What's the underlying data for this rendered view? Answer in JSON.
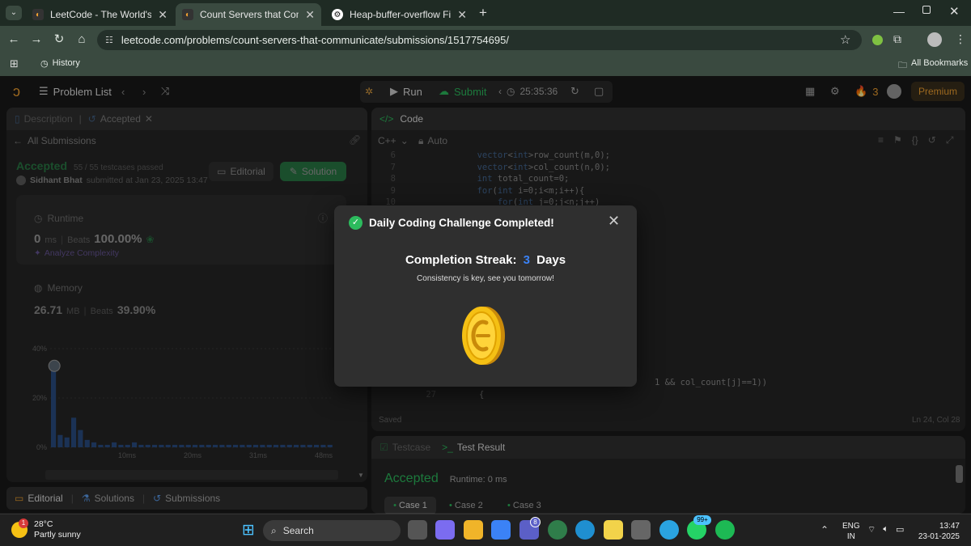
{
  "browser": {
    "tabs": [
      {
        "title": "LeetCode - The World's Leading",
        "active": false
      },
      {
        "title": "Count Servers that Communicat",
        "active": true
      },
      {
        "title": "Heap-buffer-overflow Fix",
        "active": false
      }
    ],
    "url": "leetcode.com/problems/count-servers-that-communicate/submissions/1517754695/",
    "bookmarks_left": "History",
    "bookmarks_right": "All Bookmarks"
  },
  "header": {
    "problem_list": "Problem List",
    "run": "Run",
    "submit": "Submit",
    "timer": "25:35:36",
    "streak_count": "3",
    "premium": "Premium"
  },
  "left": {
    "tabs": {
      "description": "Description",
      "accepted": "Accepted"
    },
    "all_submissions": "All Submissions",
    "status": "Accepted",
    "testcases": "55 / 55 testcases passed",
    "user": "Sidhant Bhat",
    "submitted": "submitted at Jan 23, 2025 13:47",
    "editorial_btn": "Editorial",
    "solution_btn": "Solution",
    "runtime_label": "Runtime",
    "runtime_value": "0",
    "runtime_unit": "ms",
    "beats_label": "Beats",
    "runtime_beats": "100.00%",
    "analyze": "Analyze Complexity",
    "memory_label": "Memory",
    "memory_value": "26.71",
    "memory_unit": "MB",
    "memory_beats": "39.90%",
    "bottom_tabs": {
      "editorial": "Editorial",
      "solutions": "Solutions",
      "submissions": "Submissions"
    }
  },
  "chart_data": {
    "type": "bar",
    "y_ticks": [
      "40%",
      "20%",
      "0%"
    ],
    "x_ticks": [
      "10ms",
      "20ms",
      "31ms",
      "48ms"
    ],
    "ylim": [
      0,
      40
    ],
    "values": [
      34,
      5,
      4,
      12,
      7,
      3,
      2,
      1,
      1,
      2,
      1,
      1,
      2,
      1,
      1,
      1,
      1,
      1,
      1,
      1,
      1,
      1,
      1,
      1,
      1,
      1,
      1,
      1,
      1,
      1,
      1,
      1,
      1,
      1,
      1,
      1,
      1,
      1,
      1,
      1,
      1,
      1
    ]
  },
  "code_panel": {
    "title": "Code",
    "language": "C++",
    "mode": "Auto",
    "lines": [
      {
        "n": "6",
        "text": "        vector<int>row_count(m,0);"
      },
      {
        "n": "7",
        "text": "        vector<int>col_count(n,0);"
      },
      {
        "n": "8",
        "text": "        int total_count=0;"
      },
      {
        "n": "9",
        "text": "        for(int i=0;i<m;i++){"
      },
      {
        "n": "10",
        "text": "            for(int j=0;j<n;j++)"
      }
    ],
    "line26_tail": "1 && col_count[j]==1))",
    "line27_n": "27",
    "line27_text": "{",
    "saved": "Saved",
    "cursor": "Ln 24, Col 28"
  },
  "bottom_panel": {
    "testcase_tab": "Testcase",
    "result_tab": "Test Result",
    "status": "Accepted",
    "runtime": "Runtime: 0 ms",
    "cases": [
      "Case 1",
      "Case 2",
      "Case 3"
    ]
  },
  "modal": {
    "title": "Daily Coding Challenge Completed!",
    "streak_label": "Completion Streak:",
    "streak_num": "3",
    "streak_unit": "Days",
    "message": "Consistency is key, see you tomorrow!"
  },
  "taskbar": {
    "temp": "28°C",
    "weather": "Partly sunny",
    "weather_badge": "1",
    "search": "Search",
    "teams_badge": "8",
    "whatsapp_badge": "99+",
    "lang": "ENG",
    "region": "IN",
    "time": "13:47",
    "date": "23-01-2025"
  }
}
